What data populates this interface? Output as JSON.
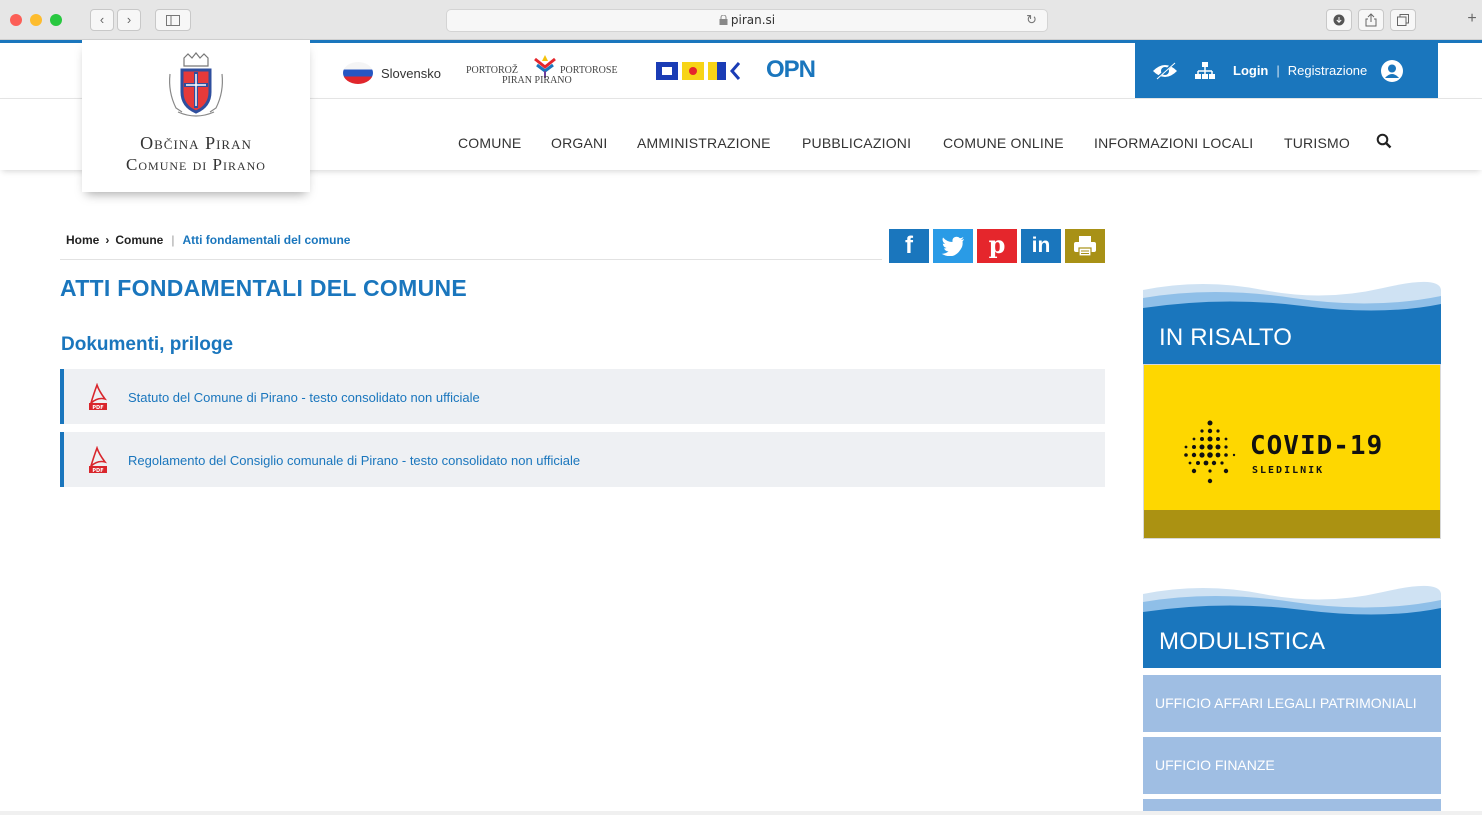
{
  "browser": {
    "url": "piran.si",
    "lock_icon": "lock-icon"
  },
  "logo": {
    "line1": "Občina Piran",
    "line2": "Comune di Pirano"
  },
  "topbar": {
    "language": "Slovensko",
    "portoroz_left_top": "PORTOROŽ",
    "portoroz_right_top": "PORTOROSE",
    "portoroz_bottom": "PIRAN  PIRANO",
    "opn": "OPN",
    "login": "Login",
    "register": "Registrazione"
  },
  "nav": {
    "items": [
      "COMUNE",
      "ORGANI",
      "AMMINISTRAZIONE",
      "PUBBLICAZIONI",
      "COMUNE ONLINE",
      "INFORMAZIONI LOCALI",
      "TURISMO"
    ]
  },
  "breadcrumb": {
    "home": "Home",
    "separator": "›",
    "section": "Comune",
    "current": "Atti fondamentali del comune"
  },
  "share": {
    "facebook": "f",
    "pinterest": "p",
    "linkedin": "in"
  },
  "content": {
    "title": "ATTI FONDAMENTALI DEL COMUNE",
    "section_title": "Dokumenti, priloge",
    "documents": [
      "Statuto del Comune di Pirano - testo consolidato non ufficiale",
      "Regolamento del Consiglio comunale di Pirano - testo consolidato non ufficiale"
    ]
  },
  "sidebar": {
    "highlight_title": "IN RISALTO",
    "covid_main": "COVID-19",
    "covid_sub": "SLEDILNIK",
    "forms_title": "MODULISTICA",
    "forms_items": [
      "UFFICIO AFFARI LEGALI PATRIMONIALI",
      "UFFICIO FINANZE"
    ]
  },
  "colors": {
    "brand_blue": "#1a76bd",
    "covid_yellow": "#fed700",
    "light_blue_item": "#9fbee3"
  }
}
